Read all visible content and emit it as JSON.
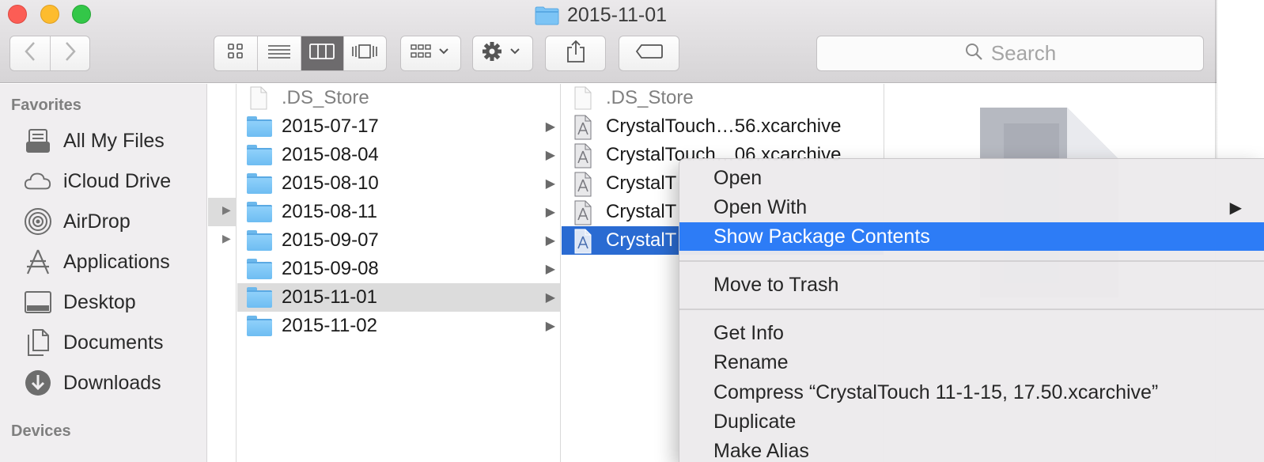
{
  "window": {
    "title": "2015-11-01"
  },
  "toolbar": {
    "back_icon": "chevron-left-icon",
    "forward_icon": "chevron-right-icon",
    "views": [
      "icon-view",
      "list-view",
      "column-view",
      "cover-flow-view"
    ],
    "active_view": "column-view",
    "search_placeholder": "Search"
  },
  "sidebar": {
    "favorites_header": "Favorites",
    "items": [
      {
        "label": "All My Files",
        "icon": "all-files-icon"
      },
      {
        "label": "iCloud Drive",
        "icon": "cloud-icon"
      },
      {
        "label": "AirDrop",
        "icon": "airdrop-icon"
      },
      {
        "label": "Applications",
        "icon": "applications-icon"
      },
      {
        "label": "Desktop",
        "icon": "desktop-icon"
      },
      {
        "label": "Documents",
        "icon": "documents-icon"
      },
      {
        "label": "Downloads",
        "icon": "downloads-icon"
      }
    ],
    "devices_header": "Devices"
  },
  "column2": {
    "items": [
      {
        "name": ".DS_Store",
        "type": "file",
        "dim": true
      },
      {
        "name": "2015-07-17",
        "type": "folder"
      },
      {
        "name": "2015-08-04",
        "type": "folder"
      },
      {
        "name": "2015-08-10",
        "type": "folder"
      },
      {
        "name": "2015-08-11",
        "type": "folder"
      },
      {
        "name": "2015-09-07",
        "type": "folder"
      },
      {
        "name": "2015-09-08",
        "type": "folder"
      },
      {
        "name": "2015-11-01",
        "type": "folder",
        "selected": true
      },
      {
        "name": "2015-11-02",
        "type": "folder"
      }
    ]
  },
  "column3": {
    "items": [
      {
        "name": ".DS_Store",
        "type": "file",
        "dim": true
      },
      {
        "name": "CrystalTouch…56.xcarchive",
        "type": "archive"
      },
      {
        "name": "CrystalTouch…06.xcarchive",
        "type": "archive"
      },
      {
        "name": "CrystalT",
        "type": "archive"
      },
      {
        "name": "CrystalT",
        "type": "archive"
      },
      {
        "name": "CrystalT",
        "type": "archive",
        "selected": true
      }
    ]
  },
  "context_menu": {
    "open": "Open",
    "open_with": "Open With",
    "show_package_contents": "Show Package Contents",
    "move_to_trash": "Move to Trash",
    "get_info": "Get Info",
    "rename": "Rename",
    "compress": "Compress “CrystalTouch 11-1-15, 17.50.xcarchive”",
    "duplicate": "Duplicate",
    "make_alias": "Make Alias"
  },
  "colors": {
    "selection_blue": "#2a6bd2",
    "menu_highlight": "#2d7cf6",
    "folder_blue": "#7cc4f5"
  }
}
